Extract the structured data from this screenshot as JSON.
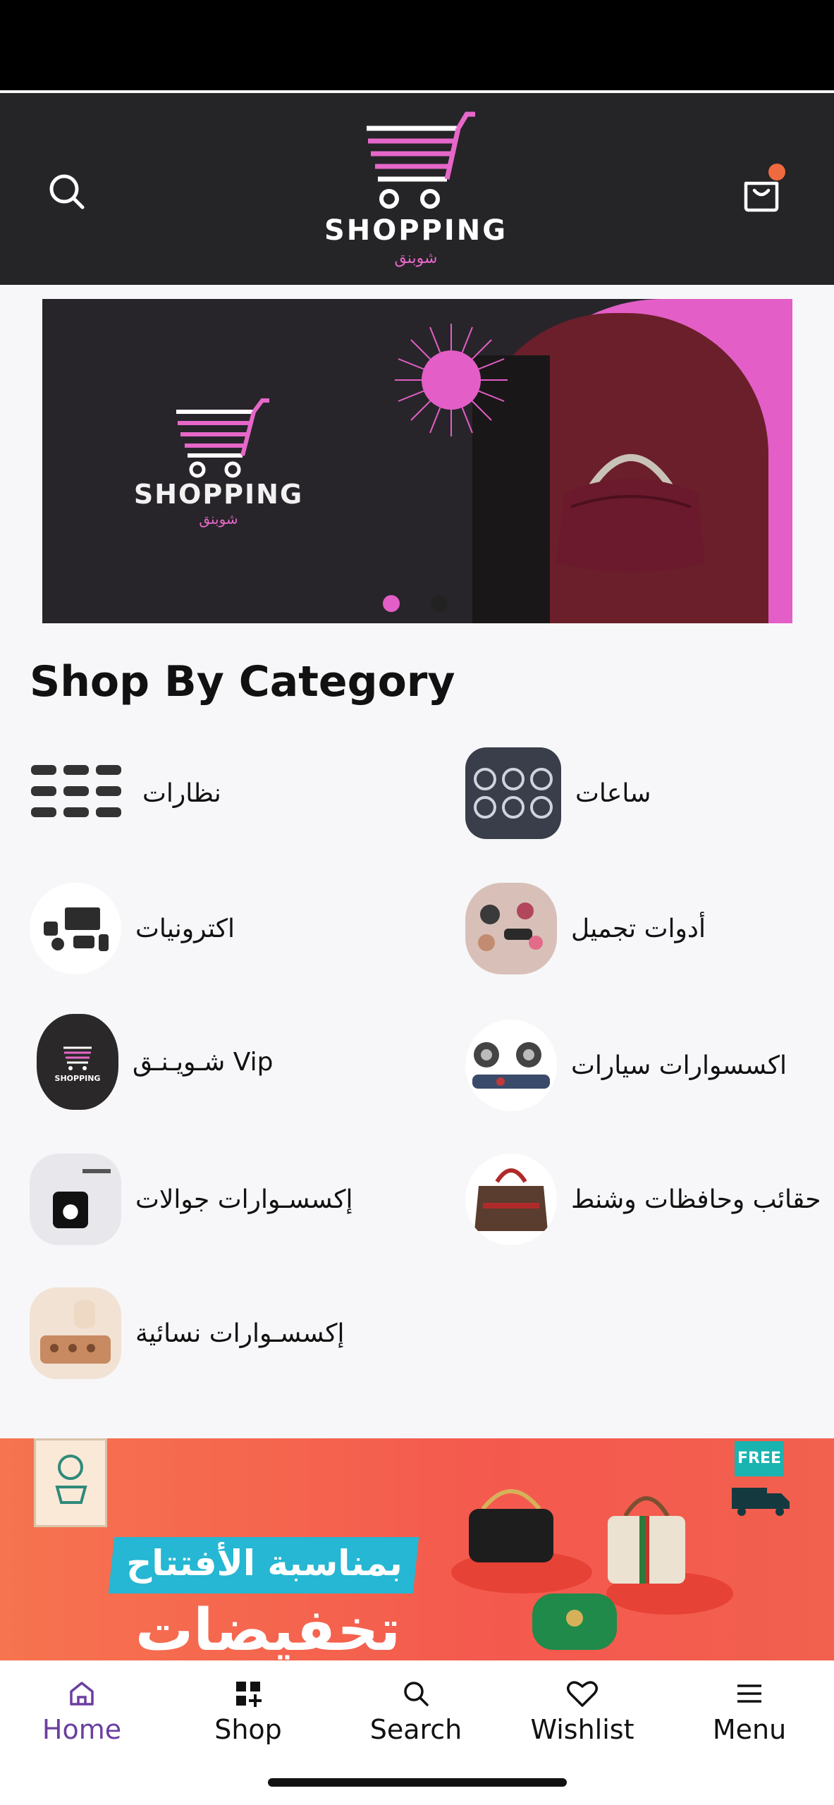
{
  "header": {
    "logo_word": "SHOPPING",
    "logo_arabic": "شوبنق",
    "cart_badge_color": "#ef6a3e"
  },
  "banner": {
    "logo_word": "SHOPPING",
    "logo_arabic": "شوبنق",
    "accent_color": "#e35ec6",
    "slides_count": 2,
    "active_slide": 1
  },
  "section_title": "Shop By Category",
  "categories": [
    {
      "label": "نظارات",
      "icon": "sunglasses-icon"
    },
    {
      "label": "ساعات",
      "icon": "watches-icon"
    },
    {
      "label": "اكترونيات",
      "icon": "electronics-icon"
    },
    {
      "label": "أدوات تجميل",
      "icon": "cosmetics-icon"
    },
    {
      "label": "شـويـنـق Vip",
      "icon": "shopping-vip-icon"
    },
    {
      "label": "اكسسوارات سيارات",
      "icon": "car-accessories-icon"
    },
    {
      "label": "إكسسـوارات جوالات",
      "icon": "phone-accessories-icon"
    },
    {
      "label": "حقائب وحافظات وشنط",
      "icon": "bags-icon"
    },
    {
      "label": "إكسسـوارات نسائية",
      "icon": "women-accessories-icon"
    }
  ],
  "promo": {
    "line1": "بمناسبة الأفتتاح",
    "line2": "تخفيضات",
    "free_badge": "FREE"
  },
  "tabs": [
    {
      "label": "Home",
      "icon": "home-icon",
      "active": true
    },
    {
      "label": "Shop",
      "icon": "grid-plus-icon",
      "active": false
    },
    {
      "label": "Search",
      "icon": "search-icon",
      "active": false
    },
    {
      "label": "Wishlist",
      "icon": "heart-icon",
      "active": false
    },
    {
      "label": "Menu",
      "icon": "menu-icon",
      "active": false
    }
  ]
}
